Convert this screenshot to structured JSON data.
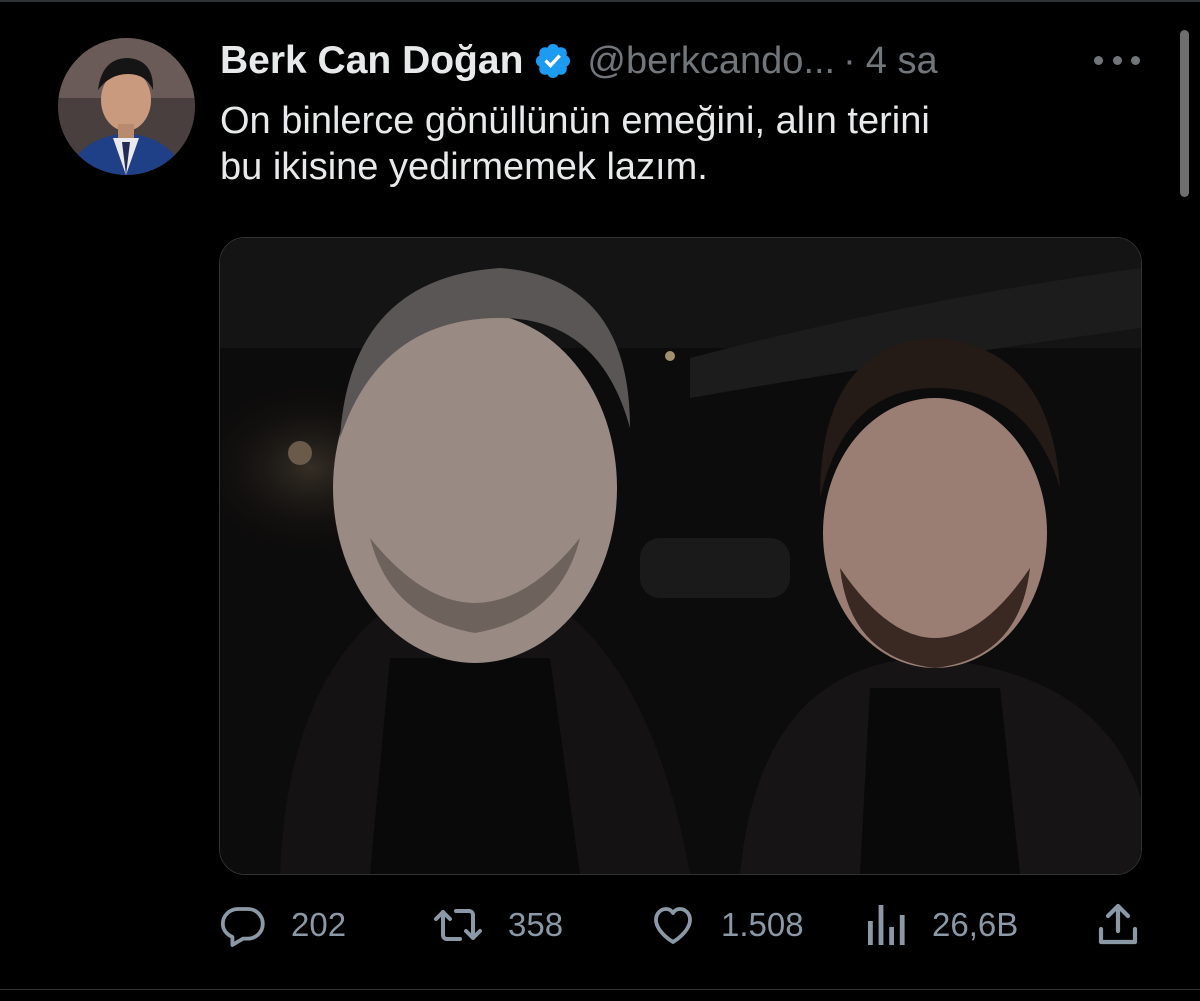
{
  "tweet": {
    "author": {
      "display_name": "Berk Can Doğan",
      "handle": "@berkcando...",
      "verified": true,
      "separator": "·",
      "time": "4 sa"
    },
    "text_lines": [
      "On binlerce gönüllünün emeğini, alın terini",
      "bu ikisine yedirmemek lazım."
    ],
    "media": {
      "kind": "photo",
      "people_count": 2
    },
    "actions": {
      "replies": "202",
      "retweets": "358",
      "likes": "1.508",
      "views": "26,6B"
    }
  },
  "icons": {
    "more": "more-dots-icon",
    "verified": "verified-badge-icon",
    "reply": "reply-icon",
    "retweet": "retweet-icon",
    "like": "heart-icon",
    "views": "views-icon",
    "share": "share-icon"
  },
  "colors": {
    "background": "#000000",
    "primary_text": "#e7e9ea",
    "secondary_text": "#71767b",
    "action_text": "#8b98a5",
    "verified_blue": "#1d9bf0",
    "divider": "#2f3336"
  }
}
